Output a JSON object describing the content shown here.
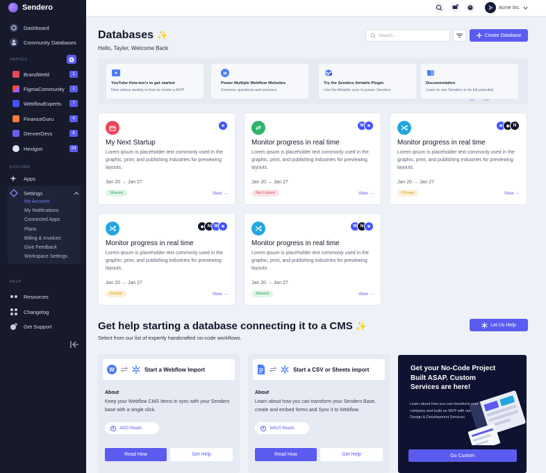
{
  "app": {
    "name": "Sendero"
  },
  "sidebar": {
    "top_items": [
      {
        "label": "Dashboard"
      },
      {
        "label": "Community Databases"
      }
    ],
    "sapces_label": "SAPCES",
    "spaces": [
      {
        "label": "BrandWeld",
        "count": "1",
        "color": "#e9475b"
      },
      {
        "label": "FigmaCommunity",
        "count": "1",
        "color": "#f24e1e"
      },
      {
        "label": "WebflowExperts",
        "count": "7",
        "color": "#4353ff"
      },
      {
        "label": "FinanceGuru",
        "count": "4",
        "color": "#ff7a3d"
      },
      {
        "label": "DenverDevs",
        "count": "6",
        "color": "#6a5cf2"
      },
      {
        "label": "Hexigon",
        "count": "24",
        "color": "#dfe4f2"
      }
    ],
    "explore_label": "EXPLORE",
    "apps_label": "Apps",
    "settings_label": "Settings",
    "settings_items": [
      {
        "label": "My Account"
      },
      {
        "label": "My Notifications"
      },
      {
        "label": "Connected Apps"
      },
      {
        "label": "Plans"
      },
      {
        "label": "Billing & Invoices"
      },
      {
        "label": "Give Feedback"
      },
      {
        "label": "Workspace Settings"
      }
    ],
    "help_label": "HELP",
    "help_items": [
      {
        "label": "Resources"
      },
      {
        "label": "Changelog"
      },
      {
        "label": "Get Support"
      }
    ]
  },
  "topbar": {
    "account_name": "Acme Inc."
  },
  "header": {
    "title": "Databases",
    "sparkle": "✨",
    "welcome": "Hello, Tayler, Welcome Back",
    "search_placeholder": "Search...",
    "create_label": "Create Database"
  },
  "resources": [
    {
      "title": "YouTube How-too's to get started",
      "desc": "New videos weekly in how to create a MVP"
    },
    {
      "title": "Power Multiple Webflow Websites",
      "desc": "Common questions and answers"
    },
    {
      "title": "Try the Sendero Airtable Plugin",
      "desc": "Use the Airtable sync to power Sendero"
    },
    {
      "title": "Documentation",
      "desc": "Learn to use Sendero to its full potential"
    }
  ],
  "databases": [
    {
      "title": "My Next Startup",
      "desc": "Lorem ipsum is placeholder text commonly used in the graphic, print, and publishing industries for previewing layouts.",
      "dates": "Jan 20 → Jan 27",
      "status": "Shared",
      "view": "View →",
      "icon_color": "#e9475b"
    },
    {
      "title": "Monitor progress in real time",
      "desc": "Lorem ipsum is placeholder text commonly used in the graphic, print, and publishing industries for previewing layouts.",
      "dates": "Jan 20 → Jan 27",
      "status": "Not Linked",
      "view": "View →",
      "icon_color": "#2fb36b"
    },
    {
      "title": "Monitor progress in real time",
      "desc": "Lorem ipsum is placeholder text commonly used in the graphic, print, and publishing industries for previewing layouts.",
      "dates": "Jan 20 → Jan 27",
      "status": "Private",
      "view": "View →",
      "icon_color": "#23a6e0"
    },
    {
      "title": "Monitor progress in real time",
      "desc": "Lorem ipsum is placeholder text commonly used in the graphic, print, and publishing industries for previewing layouts.",
      "dates": "Jan 20 → Jan 27",
      "status": "Private",
      "view": "View →",
      "icon_color": "#23a6e0"
    },
    {
      "title": "Monitor progress in real time",
      "desc": "Lorem ipsum is placeholder text commonly used in the graphic, print, and publishing industries for previewing layouts.",
      "dates": "Jan 20 → Jan 27",
      "status": "Shared",
      "view": "View →",
      "icon_color": "#23a6e0"
    }
  ],
  "help": {
    "title": "Get help starting a database connecting it to a CMS",
    "sparkle": "✨",
    "subtitle": "Select from our list of expertly handcrafted no-code workflows.",
    "button": "Let Us Help"
  },
  "workflows": [
    {
      "title": "Start a Webflow Import",
      "about_label": "About",
      "about": "Keep your Webflow CMS Items in sync with your Sendero base with a single click.",
      "reads": "3420 Reads",
      "read_btn": "Read How",
      "help_btn": "Get Help"
    },
    {
      "title": "Start a CSV or Sheets import",
      "about_label": "About",
      "about": "Learn about how you can transform your Sendero Base, create and embed forms and Sync it to Webflow.",
      "reads": "34520 Reads",
      "read_btn": "Read How",
      "help_btn": "Get Help"
    }
  ],
  "promo": {
    "title": "Get your No-Code Project Built ASAP. Custom Services are here!",
    "desc": "Learn about how you can transform your company and build an MVP with our Design & Development Services.",
    "button": "Go Custom"
  },
  "colors": {
    "accent": "#5b5bf0",
    "sidebar_bg": "#161a2b",
    "page_bg": "#eef1f7"
  }
}
